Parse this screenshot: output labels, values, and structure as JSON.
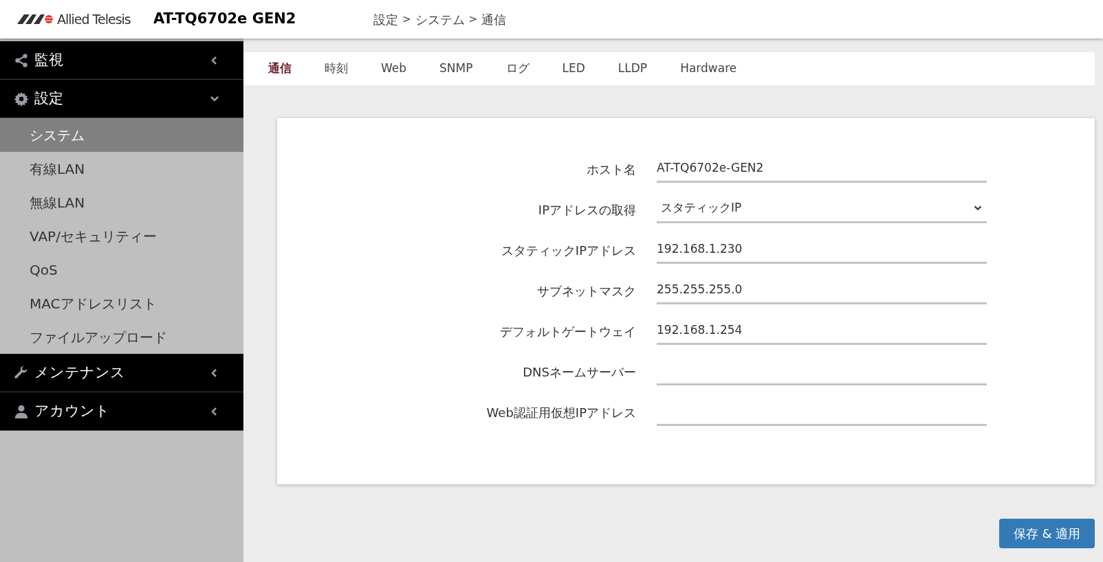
{
  "header": {
    "brand": "Allied Telesis",
    "model": "AT-TQ6702e GEN2",
    "breadcrumb": [
      "設定",
      "システム",
      "通信"
    ],
    "separator": ">"
  },
  "sidebar": {
    "groups": [
      {
        "label": "監視",
        "expanded": false
      },
      {
        "label": "設定",
        "expanded": true,
        "items": [
          {
            "label": "システム",
            "selected": true
          },
          {
            "label": "有線LAN",
            "selected": false
          },
          {
            "label": "無線LAN",
            "selected": false
          },
          {
            "label": "VAP/セキュリティー",
            "selected": false
          },
          {
            "label": "QoS",
            "selected": false
          },
          {
            "label": "MACアドレスリスト",
            "selected": false
          },
          {
            "label": "ファイルアップロード",
            "selected": false
          }
        ]
      },
      {
        "label": "メンテナンス",
        "expanded": false
      },
      {
        "label": "アカウント",
        "expanded": false
      }
    ]
  },
  "tabs": [
    {
      "label": "通信",
      "selected": true
    },
    {
      "label": "時刻",
      "selected": false
    },
    {
      "label": "Web",
      "selected": false
    },
    {
      "label": "SNMP",
      "selected": false
    },
    {
      "label": "ログ",
      "selected": false
    },
    {
      "label": "LED",
      "selected": false
    },
    {
      "label": "LLDP",
      "selected": false
    },
    {
      "label": "Hardware",
      "selected": false
    }
  ],
  "form": {
    "fields": [
      {
        "label": "ホスト名",
        "kind": "text",
        "value": "AT-TQ6702e-GEN2"
      },
      {
        "label": "IPアドレスの取得",
        "kind": "select",
        "value": "スタティックIP"
      },
      {
        "label": "スタティックIPアドレス",
        "kind": "text",
        "value": "192.168.1.230"
      },
      {
        "label": "サブネットマスク",
        "kind": "text",
        "value": "255.255.255.0"
      },
      {
        "label": "デフォルトゲートウェイ",
        "kind": "text",
        "value": "192.168.1.254"
      },
      {
        "label": "DNSネームサーバー",
        "kind": "text"
      },
      {
        "label": "Web認証用仮想IPアドレス",
        "kind": "text"
      }
    ]
  },
  "save_button": "保存 & 適用"
}
